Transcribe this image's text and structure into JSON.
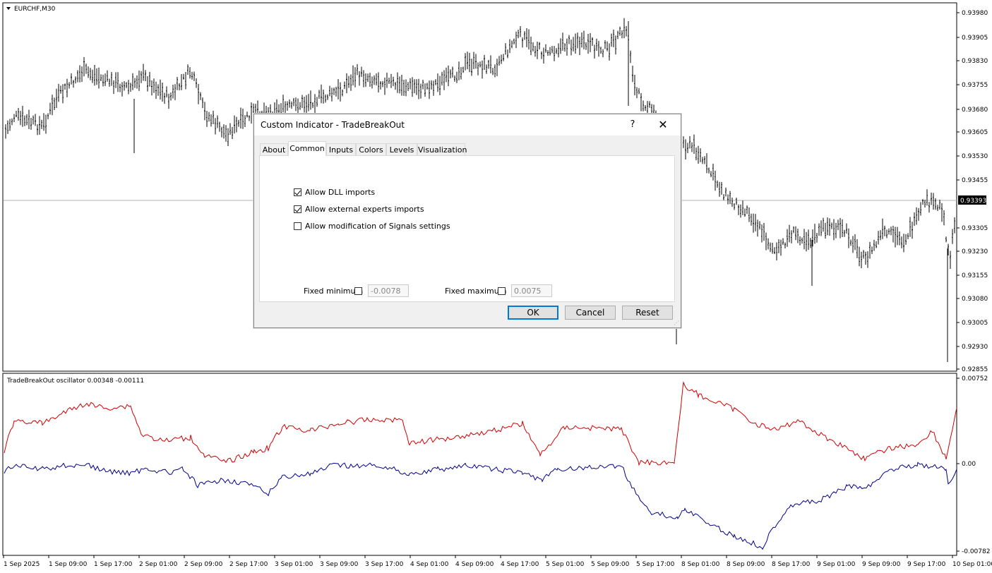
{
  "main_chart": {
    "symbol_label": "EURCHF,M30",
    "price_ticks": [
      "0.93980",
      "0.93905",
      "0.93830",
      "0.93755",
      "0.93680",
      "0.93605",
      "0.93530",
      "0.93455",
      "0.93305",
      "0.93230",
      "0.93155",
      "0.93080",
      "0.93005",
      "0.92930",
      "0.92855"
    ],
    "current_price": "0.93393"
  },
  "oscillator": {
    "label": "TradeBreakOut oscillator 0.00348 -0.00111",
    "ticks": [
      "0.00752",
      "0.00",
      "-0.00782"
    ],
    "colors": {
      "signal": "#d00000",
      "main": "#00008b"
    }
  },
  "time_axis": [
    "1 Sep 2025",
    "1 Sep 09:00",
    "1 Sep 17:00",
    "2 Sep 01:00",
    "2 Sep 09:00",
    "2 Sep 17:00",
    "3 Sep 01:00",
    "3 Sep 09:00",
    "3 Sep 17:00",
    "4 Sep 01:00",
    "4 Sep 09:00",
    "4 Sep 17:00",
    "5 Sep 01:00",
    "5 Sep 09:00",
    "5 Sep 17:00",
    "8 Sep 01:00",
    "8 Sep 09:00",
    "8 Sep 17:00",
    "9 Sep 01:00",
    "9 Sep 09:00",
    "9 Sep 17:00",
    "10 Sep 01:00"
  ],
  "dialog": {
    "title": "Custom Indicator - TradeBreakOut",
    "help": "?",
    "close": "✕",
    "tabs": [
      "About",
      "Common",
      "Inputs",
      "Colors",
      "Levels",
      "Visualization"
    ],
    "active_tab": "Common",
    "checkboxes": [
      {
        "label": "Allow DLL imports",
        "checked": true
      },
      {
        "label": "Allow external experts imports",
        "checked": true
      },
      {
        "label": "Allow modification of Signals settings",
        "checked": false
      }
    ],
    "fixed_min": {
      "label": "Fixed minimum",
      "checked": false,
      "value": "-0.0078"
    },
    "fixed_max": {
      "label": "Fixed maximum",
      "checked": false,
      "value": "0.0075"
    },
    "buttons": {
      "ok": "OK",
      "cancel": "Cancel",
      "reset": "Reset"
    }
  }
}
